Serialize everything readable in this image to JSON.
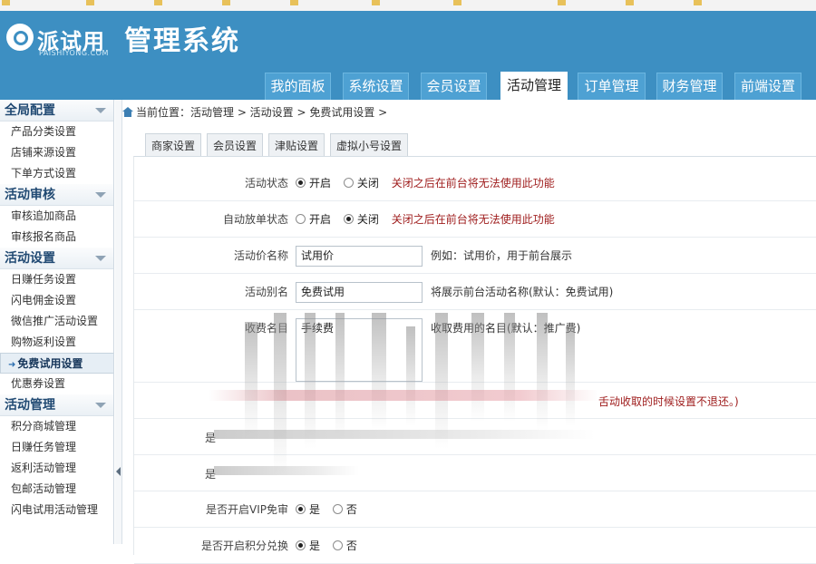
{
  "browser": {
    "bookmarks": [
      "",
      "",
      "",
      "",
      "",
      "",
      "",
      "",
      "",
      ""
    ]
  },
  "header": {
    "logo_text": "派试用",
    "logo_sub": "PAISHIYONG.COM",
    "system_title": "管理系统",
    "tabs": [
      {
        "label": "我的面板"
      },
      {
        "label": "系统设置"
      },
      {
        "label": "会员设置"
      },
      {
        "label": "活动管理"
      },
      {
        "label": "订单管理"
      },
      {
        "label": "财务管理"
      },
      {
        "label": "前端设置"
      }
    ],
    "active_tab": "活动管理"
  },
  "sidebar": {
    "sections": [
      {
        "title": "全局配置",
        "items": [
          "产品分类设置",
          "店铺来源设置",
          "下单方式设置"
        ]
      },
      {
        "title": "活动审核",
        "items": [
          "审核追加商品",
          "审核报名商品"
        ]
      },
      {
        "title": "活动设置",
        "items": [
          "日赚任务设置",
          "闪电佣金设置",
          "微信推广活动设置",
          "购物返利设置",
          "免费试用设置",
          "优惠券设置"
        ]
      },
      {
        "title": "活动管理",
        "items": [
          "积分商城管理",
          "日赚任务管理",
          "返利活动管理",
          "包邮活动管理",
          "闪电试用活动管理"
        ]
      }
    ],
    "active_item": "免费试用设置"
  },
  "breadcrumb": "当前位置：活动管理 > 活动设置 > 免费试用设置 >",
  "subtabs": [
    "商家设置",
    "会员设置",
    "津贴设置",
    "虚拟小号设置"
  ],
  "form": {
    "activity_status": {
      "label": "活动状态",
      "options": [
        "开启",
        "关闭"
      ],
      "selected": "开启",
      "warning": "关闭之后在前台将无法使用此功能"
    },
    "auto_settle": {
      "label": "自动放单状态",
      "options": [
        "开启",
        "关闭"
      ],
      "selected": "关闭",
      "warning": "关闭之后在前台将无法使用此功能"
    },
    "price_name": {
      "label": "活动价名称",
      "value": "试用价",
      "hint": "例如：试用价，用于前台展示"
    },
    "alias": {
      "label": "活动别名",
      "value": "免费试用",
      "hint": "将展示前台活动名称(默认：免费试用)"
    },
    "fee_name": {
      "label": "收费名目",
      "value": "手续费",
      "hint": "收取费用的名目(默认：推广费)"
    },
    "refund_note": "舌动收取的时候设置不退还。)",
    "row_shi_1": "是",
    "row_shi_2": "是",
    "vip_free": {
      "label": "是否开启VIP免审",
      "options": [
        "是",
        "否"
      ],
      "selected": "是"
    },
    "points_exchange": {
      "label": "是否开启积分兑换",
      "options": [
        "是",
        "否"
      ],
      "selected": "是"
    }
  }
}
